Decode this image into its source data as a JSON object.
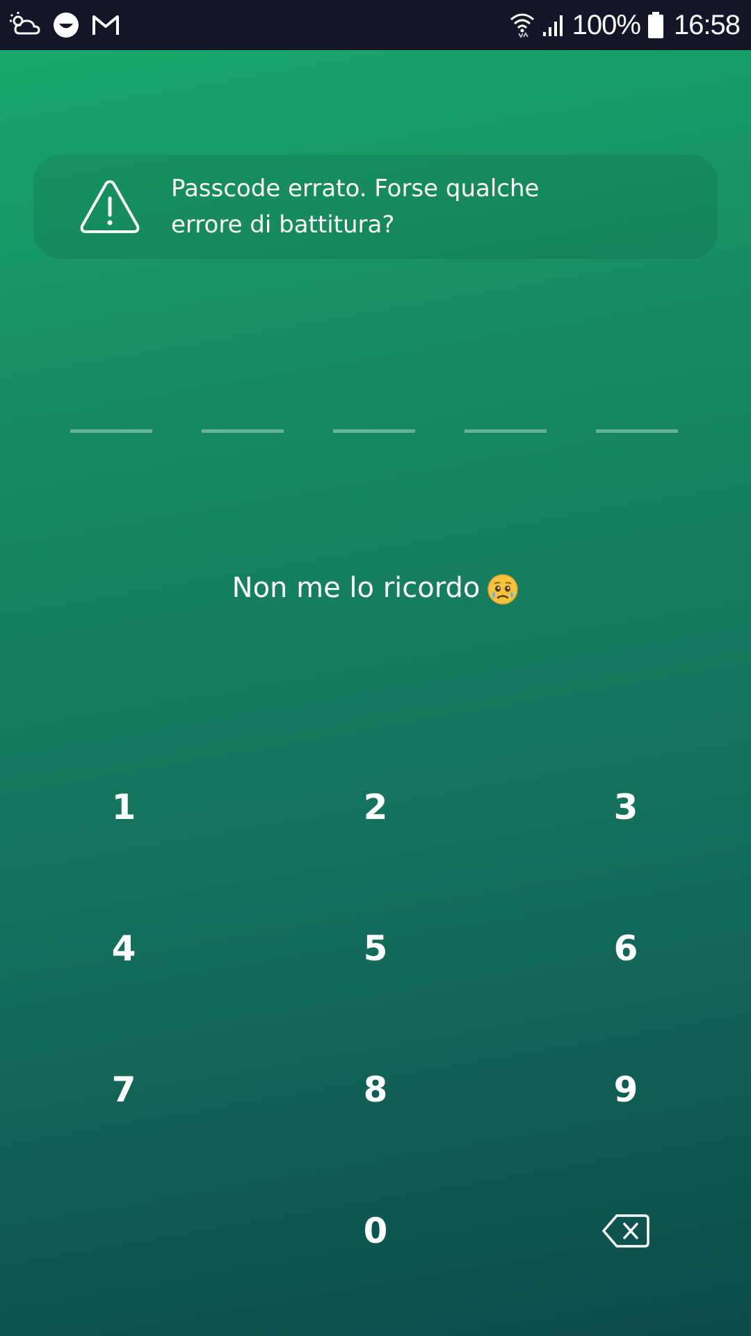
{
  "status_bar": {
    "left_icons": [
      "weather-icon",
      "chat-app-icon",
      "gmail-icon"
    ],
    "battery_percent": "100%",
    "time": "16:58"
  },
  "error_banner": {
    "icon": "warning-icon",
    "message": "Passcode errato. Forse qualche errore di battitura?"
  },
  "passcode": {
    "length": 5,
    "entered": 0
  },
  "forgot": {
    "label": "Non me lo ricordo",
    "emoji": "crying-face-icon"
  },
  "keypad": {
    "keys": [
      "1",
      "2",
      "3",
      "4",
      "5",
      "6",
      "7",
      "8",
      "9",
      "0"
    ],
    "backspace_icon": "backspace-icon"
  },
  "colors": {
    "gradient_top": "#1aaa6c",
    "gradient_bottom": "#0c4a4c",
    "status_bar": "#15152a"
  }
}
